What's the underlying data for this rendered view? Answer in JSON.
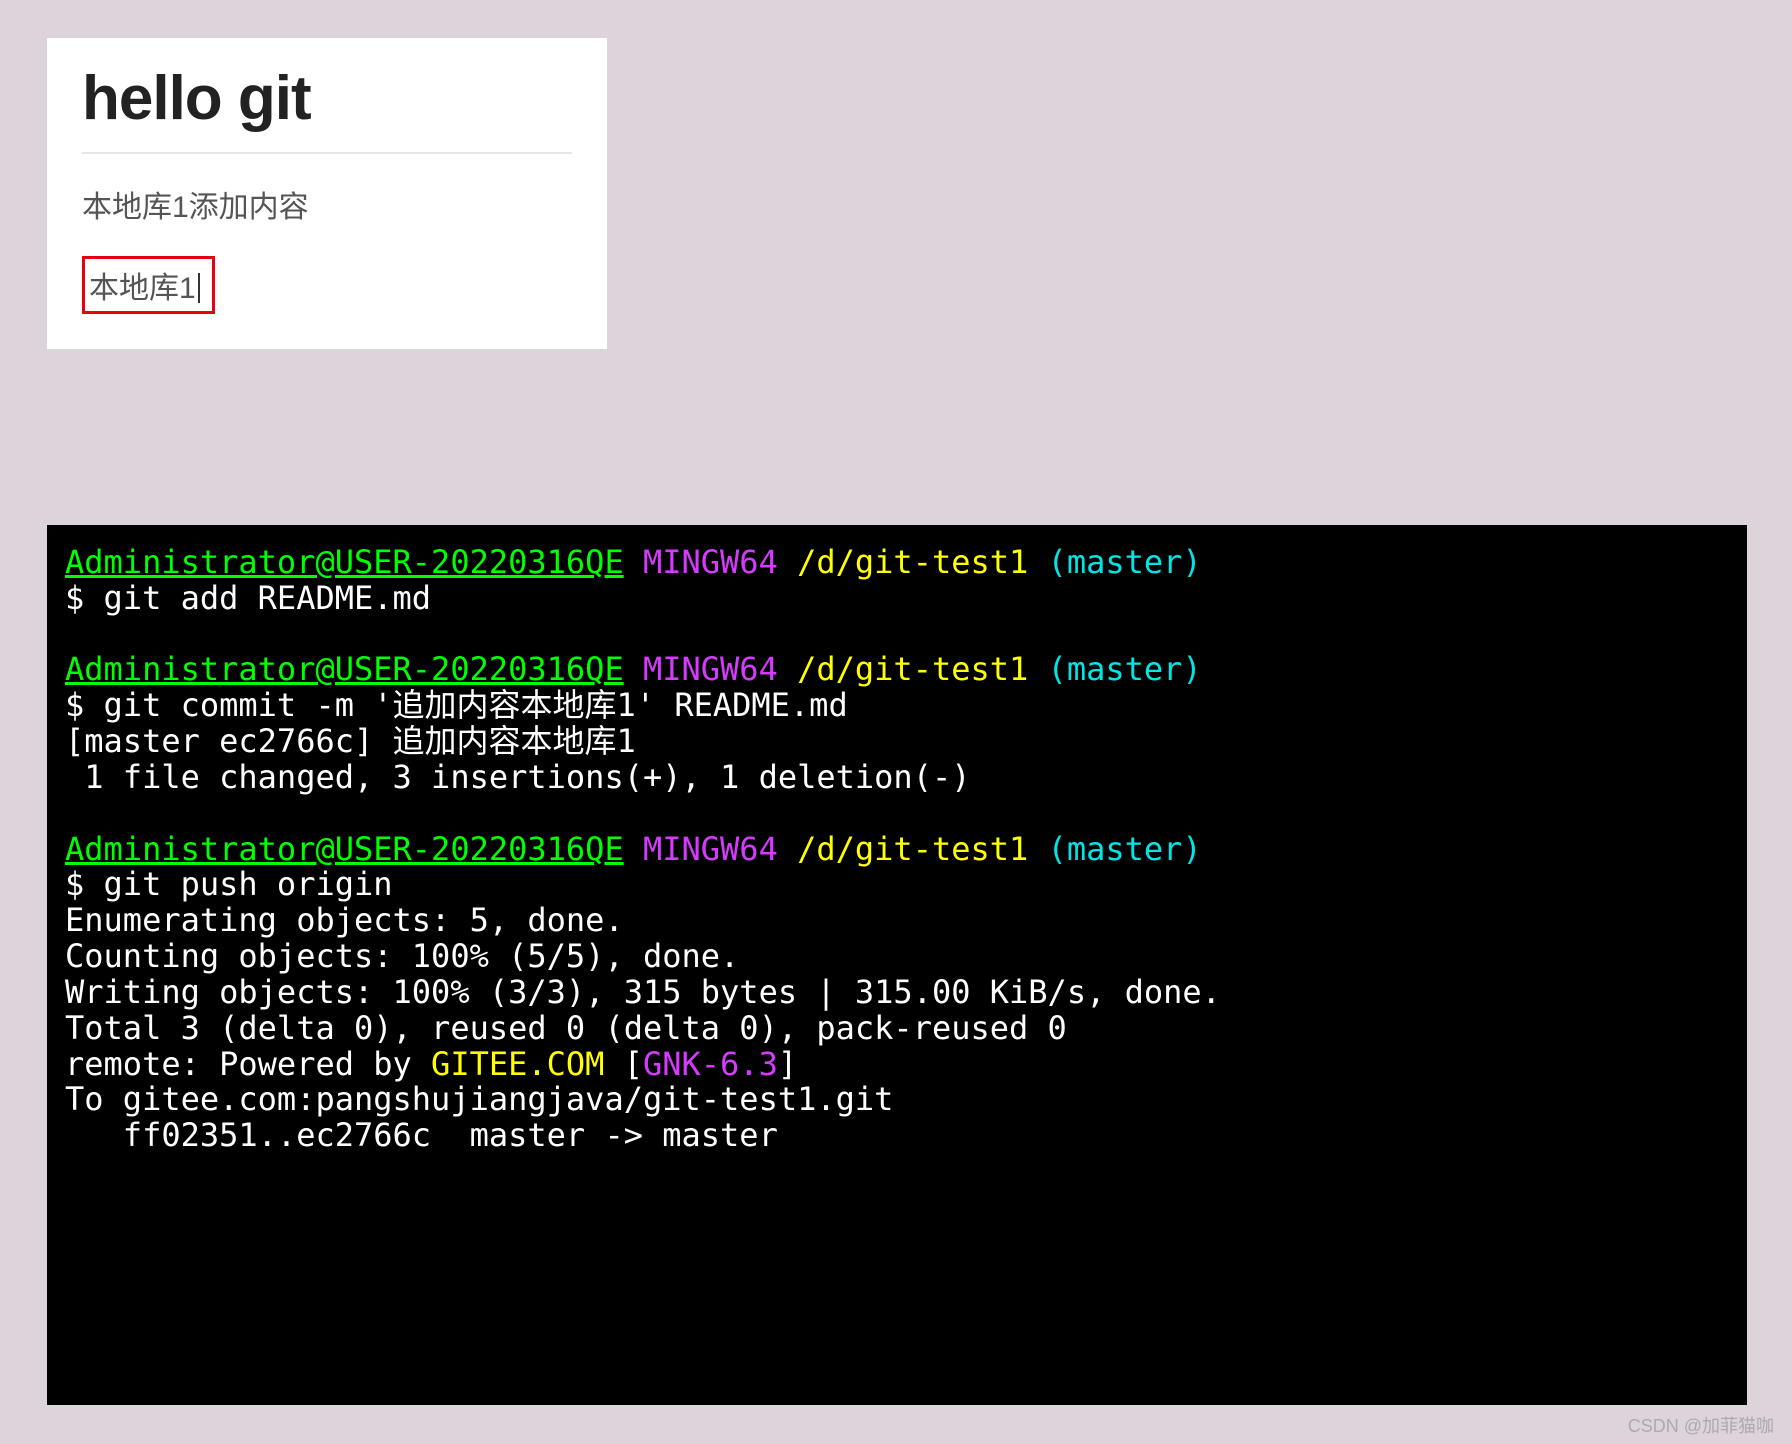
{
  "readme": {
    "title": "hello git",
    "line1": "本地库1添加内容",
    "line2": "本地库1"
  },
  "terminal": {
    "prompt": {
      "user_host": "Administrator@USER-20220316QE",
      "shell": "MINGW64",
      "path": "/d/git-test1",
      "branch": "(master)",
      "ps1": "$"
    },
    "cmd1": "git add README.md",
    "cmd2": "git commit -m '追加内容本地库1' README.md",
    "out2_l1": "[master ec2766c] 追加内容本地库1",
    "out2_l2": " 1 file changed, 3 insertions(+), 1 deletion(-)",
    "cmd3": "git push origin",
    "out3_l1": "Enumerating objects: 5, done.",
    "out3_l2": "Counting objects: 100% (5/5), done.",
    "out3_l3": "Writing objects: 100% (3/3), 315 bytes | 315.00 KiB/s, done.",
    "out3_l4": "Total 3 (delta 0), reused 0 (delta 0), pack-reused 0",
    "out3_remote_prefix": "remote: Powered by ",
    "out3_gitee": "GITEE.COM",
    "out3_bracket_open": " [",
    "out3_gnk": "GNK-6.3",
    "out3_bracket_close": "]",
    "out3_to": "To gitee.com:pangshujiangjava/git-test1.git",
    "out3_refs": "   ff02351..ec2766c  master -> master"
  },
  "watermark": "CSDN @加菲猫咖"
}
